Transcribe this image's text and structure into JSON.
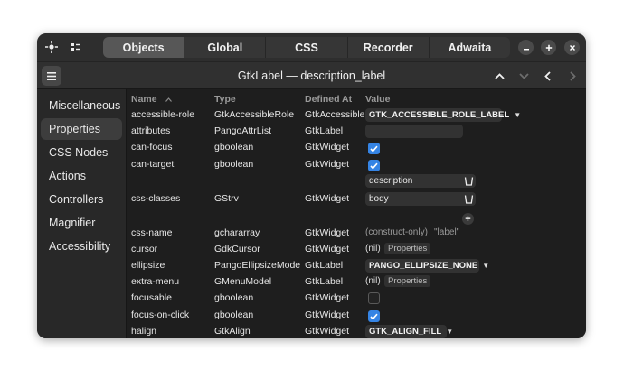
{
  "header": {
    "tabs": [
      {
        "label": "Objects",
        "active": true
      },
      {
        "label": "Global",
        "active": false
      },
      {
        "label": "CSS",
        "active": false
      },
      {
        "label": "Recorder",
        "active": false
      },
      {
        "label": "Adwaita",
        "active": false
      }
    ],
    "left_icons": [
      "crosshair-icon",
      "object-tree-icon"
    ],
    "window_controls": [
      "minimize-icon",
      "maximize-icon",
      "close-icon"
    ]
  },
  "subheader": {
    "title": "GtkLabel — description_label",
    "icons": [
      "menu-icon",
      "chevron-up-icon",
      "chevron-down-icon",
      "chevron-left-icon",
      "chevron-right-icon"
    ]
  },
  "sidebar": {
    "items": [
      {
        "label": "Miscellaneous",
        "active": false
      },
      {
        "label": "Properties",
        "active": true
      },
      {
        "label": "CSS Nodes",
        "active": false
      },
      {
        "label": "Actions",
        "active": false
      },
      {
        "label": "Controllers",
        "active": false
      },
      {
        "label": "Magnifier",
        "active": false
      },
      {
        "label": "Accessibility",
        "active": false
      }
    ]
  },
  "table": {
    "columns": [
      "Name",
      "Type",
      "Defined At",
      "Value"
    ],
    "sort_icon": "sort-ascending-icon",
    "rows": [
      {
        "name": "accessible-role",
        "type": "GtkAccessibleRole",
        "defined": "GtkAccessible",
        "value": "GTK_ACCESSIBLE_ROLE_LABEL"
      },
      {
        "name": "attributes",
        "type": "PangoAttrList",
        "defined": "GtkLabel",
        "value": ""
      },
      {
        "name": "can-focus",
        "type": "gboolean",
        "defined": "GtkWidget",
        "value": "checked"
      },
      {
        "name": "can-target",
        "type": "gboolean",
        "defined": "GtkWidget",
        "value": "checked"
      },
      {
        "name": "css-classes",
        "type": "GStrv",
        "defined": "GtkWidget",
        "value": [
          "description",
          "body"
        ]
      },
      {
        "name": "css-name",
        "type": "gchararray",
        "defined": "GtkWidget",
        "value": "(construct-only)",
        "value2": "\"label\""
      },
      {
        "name": "cursor",
        "type": "GdkCursor",
        "defined": "GtkWidget",
        "value": "(nil)",
        "button": "Properties"
      },
      {
        "name": "ellipsize",
        "type": "PangoEllipsizeMode",
        "defined": "GtkLabel",
        "value": "PANGO_ELLIPSIZE_NONE"
      },
      {
        "name": "extra-menu",
        "type": "GMenuModel",
        "defined": "GtkLabel",
        "value": "(nil)",
        "button": "Properties"
      },
      {
        "name": "focusable",
        "type": "gboolean",
        "defined": "GtkWidget",
        "value": "unchecked"
      },
      {
        "name": "focus-on-click",
        "type": "gboolean",
        "defined": "GtkWidget",
        "value": "checked"
      },
      {
        "name": "halign",
        "type": "GtkAlign",
        "defined": "GtkWidget",
        "value": "GTK_ALIGN_FILL"
      }
    ]
  },
  "colors": {
    "accent": "#3584e4",
    "window": "#1e1e1e",
    "sidebar": "#282828",
    "headerbar": "#2e2e2e"
  }
}
